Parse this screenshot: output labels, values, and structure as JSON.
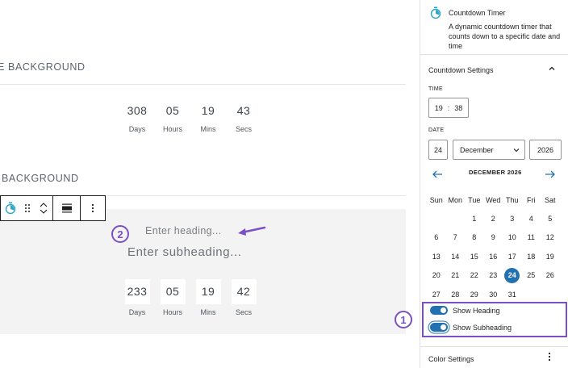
{
  "canvas": {
    "section1_title": "E BACKGROUND",
    "section2_title": "BACKGROUND",
    "countdown1": [
      {
        "num": "308",
        "label": "Days"
      },
      {
        "num": "05",
        "label": "Hours"
      },
      {
        "num": "19",
        "label": "Mins"
      },
      {
        "num": "43",
        "label": "Secs"
      }
    ],
    "heading_placeholder": "Enter heading...",
    "subheading_placeholder": "Enter subheading...",
    "countdown2": [
      {
        "num": "233",
        "label": "Days"
      },
      {
        "num": "05",
        "label": "Hours"
      },
      {
        "num": "19",
        "label": "Mins"
      },
      {
        "num": "42",
        "label": "Secs"
      }
    ],
    "annotations": {
      "badge1": "1",
      "badge2": "2",
      "accent": "#7b4fc6"
    }
  },
  "toolbar": {
    "icons": [
      "timer-block-icon",
      "drag-handle-icon",
      "move-up-icon",
      "move-down-icon",
      "align-icon",
      "more-options-icon"
    ]
  },
  "sidebar": {
    "block_name": "Countdown Timer",
    "block_desc": "A dynamic countdown timer that counts down to a specific date and time",
    "panel_title": "Countdown Settings",
    "time_label": "TIME",
    "time_hour": "19",
    "time_sep": ":",
    "time_min": "38",
    "date_label": "DATE",
    "date_day": "24",
    "date_month": "December",
    "date_year": "2026",
    "calendar": {
      "month_label": "DECEMBER 2026",
      "weekdays": [
        "Sun",
        "Mon",
        "Tue",
        "Wed",
        "Thu",
        "Fri",
        "Sat"
      ],
      "weeks": [
        [
          "",
          "",
          "1",
          "2",
          "3",
          "4",
          "5"
        ],
        [
          "6",
          "7",
          "8",
          "9",
          "10",
          "11",
          "12"
        ],
        [
          "13",
          "14",
          "15",
          "16",
          "17",
          "18",
          "19"
        ],
        [
          "20",
          "21",
          "22",
          "23",
          "24",
          "25",
          "26"
        ],
        [
          "27",
          "28",
          "29",
          "30",
          "31",
          "",
          ""
        ]
      ],
      "selected": "24"
    },
    "show_heading_label": "Show Heading",
    "show_heading_on": true,
    "show_subheading_label": "Show Subheading",
    "show_subheading_on": true,
    "color_settings_title": "Color Settings",
    "accent_color": "#2271b1"
  }
}
